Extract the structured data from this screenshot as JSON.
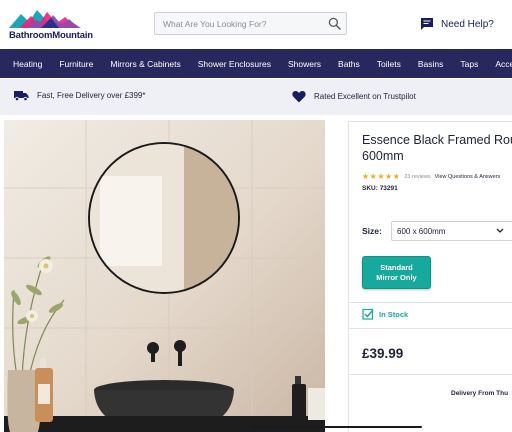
{
  "brand": {
    "name": "BathroomMountain",
    "colors": [
      "#19a9b5",
      "#e8237f",
      "#2b2f8f",
      "#8f4bb3"
    ]
  },
  "search": {
    "placeholder": "What Are You Looking For?",
    "icon": "search-icon"
  },
  "help": {
    "label": "Need Help?",
    "icon": "chat-icon"
  },
  "nav": {
    "items": [
      "Heating",
      "Furniture",
      "Mirrors & Cabinets",
      "Shower Enclosures",
      "Showers",
      "Baths",
      "Toilets",
      "Basins",
      "Taps",
      "Accessories"
    ]
  },
  "promo": {
    "delivery": {
      "text": "Fast, Free Delivery over £399*",
      "icon": "truck-icon"
    },
    "trust": {
      "text": "Rated Excellent on Trustpilot",
      "icon": "heart-icon"
    }
  },
  "product": {
    "title_line1": "Essence Black Framed Round",
    "title_line2": "600mm",
    "rating": {
      "stars": "★★★★★",
      "reviews": "23 reviews",
      "qa": "View Questions & Answers"
    },
    "sku": "SKU: 73291",
    "size": {
      "label": "Size:",
      "selected": "600 x 600mm"
    },
    "variant": {
      "line1": "Standard",
      "line2": "Mirror Only"
    },
    "stock": "In Stock",
    "price": "£39.99",
    "delivery": "Delivery From Thu"
  },
  "accent": "#17a99d",
  "nav_bg": "#26285e"
}
